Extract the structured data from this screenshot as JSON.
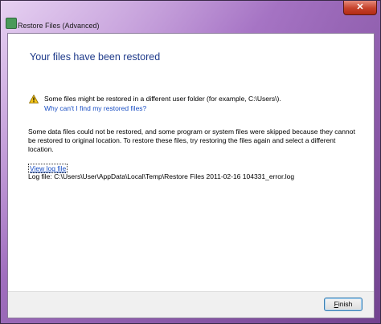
{
  "window": {
    "title": "Restore Files (Advanced)",
    "close_label": "✕"
  },
  "content": {
    "heading": "Your files have been restored",
    "warning_text": "Some files might be restored in a different user folder (for example, C:\\Users\\).",
    "warning_link": "Why can't I find my restored files?",
    "description": "Some data files could not be restored, and some program or system files were skipped because they cannot be restored to original location. To restore these files, try restoring the files again and select a different location.",
    "view_log_link": "View log file",
    "log_file": "Log file: C:\\Users\\User\\AppData\\Local\\Temp\\Restore Files 2011-02-16 104331_error.log"
  },
  "footer": {
    "finish_label_first": "F",
    "finish_label_rest": "inish"
  },
  "icons": {
    "app": "restore-app-icon",
    "warning": "warning-icon",
    "close": "close-icon"
  },
  "colors": {
    "heading": "#1e3a8a",
    "link": "#1a4fc4",
    "close_button": "#c6412b"
  }
}
